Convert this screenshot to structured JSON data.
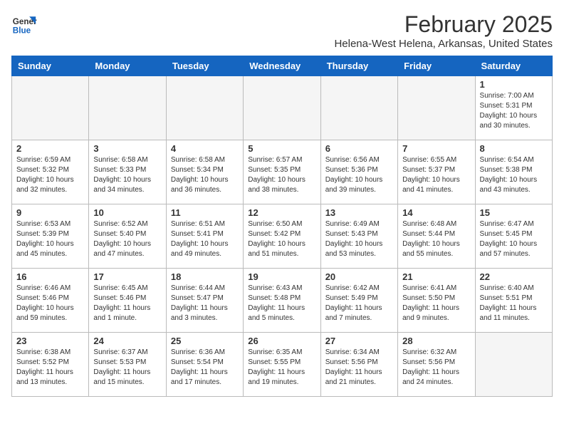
{
  "header": {
    "logo_line1": "General",
    "logo_line2": "Blue",
    "title": "February 2025",
    "subtitle": "Helena-West Helena, Arkansas, United States"
  },
  "weekdays": [
    "Sunday",
    "Monday",
    "Tuesday",
    "Wednesday",
    "Thursday",
    "Friday",
    "Saturday"
  ],
  "weeks": [
    [
      {
        "day": "",
        "info": ""
      },
      {
        "day": "",
        "info": ""
      },
      {
        "day": "",
        "info": ""
      },
      {
        "day": "",
        "info": ""
      },
      {
        "day": "",
        "info": ""
      },
      {
        "day": "",
        "info": ""
      },
      {
        "day": "1",
        "info": "Sunrise: 7:00 AM\nSunset: 5:31 PM\nDaylight: 10 hours\nand 30 minutes."
      }
    ],
    [
      {
        "day": "2",
        "info": "Sunrise: 6:59 AM\nSunset: 5:32 PM\nDaylight: 10 hours\nand 32 minutes."
      },
      {
        "day": "3",
        "info": "Sunrise: 6:58 AM\nSunset: 5:33 PM\nDaylight: 10 hours\nand 34 minutes."
      },
      {
        "day": "4",
        "info": "Sunrise: 6:58 AM\nSunset: 5:34 PM\nDaylight: 10 hours\nand 36 minutes."
      },
      {
        "day": "5",
        "info": "Sunrise: 6:57 AM\nSunset: 5:35 PM\nDaylight: 10 hours\nand 38 minutes."
      },
      {
        "day": "6",
        "info": "Sunrise: 6:56 AM\nSunset: 5:36 PM\nDaylight: 10 hours\nand 39 minutes."
      },
      {
        "day": "7",
        "info": "Sunrise: 6:55 AM\nSunset: 5:37 PM\nDaylight: 10 hours\nand 41 minutes."
      },
      {
        "day": "8",
        "info": "Sunrise: 6:54 AM\nSunset: 5:38 PM\nDaylight: 10 hours\nand 43 minutes."
      }
    ],
    [
      {
        "day": "9",
        "info": "Sunrise: 6:53 AM\nSunset: 5:39 PM\nDaylight: 10 hours\nand 45 minutes."
      },
      {
        "day": "10",
        "info": "Sunrise: 6:52 AM\nSunset: 5:40 PM\nDaylight: 10 hours\nand 47 minutes."
      },
      {
        "day": "11",
        "info": "Sunrise: 6:51 AM\nSunset: 5:41 PM\nDaylight: 10 hours\nand 49 minutes."
      },
      {
        "day": "12",
        "info": "Sunrise: 6:50 AM\nSunset: 5:42 PM\nDaylight: 10 hours\nand 51 minutes."
      },
      {
        "day": "13",
        "info": "Sunrise: 6:49 AM\nSunset: 5:43 PM\nDaylight: 10 hours\nand 53 minutes."
      },
      {
        "day": "14",
        "info": "Sunrise: 6:48 AM\nSunset: 5:44 PM\nDaylight: 10 hours\nand 55 minutes."
      },
      {
        "day": "15",
        "info": "Sunrise: 6:47 AM\nSunset: 5:45 PM\nDaylight: 10 hours\nand 57 minutes."
      }
    ],
    [
      {
        "day": "16",
        "info": "Sunrise: 6:46 AM\nSunset: 5:46 PM\nDaylight: 10 hours\nand 59 minutes."
      },
      {
        "day": "17",
        "info": "Sunrise: 6:45 AM\nSunset: 5:46 PM\nDaylight: 11 hours\nand 1 minute."
      },
      {
        "day": "18",
        "info": "Sunrise: 6:44 AM\nSunset: 5:47 PM\nDaylight: 11 hours\nand 3 minutes."
      },
      {
        "day": "19",
        "info": "Sunrise: 6:43 AM\nSunset: 5:48 PM\nDaylight: 11 hours\nand 5 minutes."
      },
      {
        "day": "20",
        "info": "Sunrise: 6:42 AM\nSunset: 5:49 PM\nDaylight: 11 hours\nand 7 minutes."
      },
      {
        "day": "21",
        "info": "Sunrise: 6:41 AM\nSunset: 5:50 PM\nDaylight: 11 hours\nand 9 minutes."
      },
      {
        "day": "22",
        "info": "Sunrise: 6:40 AM\nSunset: 5:51 PM\nDaylight: 11 hours\nand 11 minutes."
      }
    ],
    [
      {
        "day": "23",
        "info": "Sunrise: 6:38 AM\nSunset: 5:52 PM\nDaylight: 11 hours\nand 13 minutes."
      },
      {
        "day": "24",
        "info": "Sunrise: 6:37 AM\nSunset: 5:53 PM\nDaylight: 11 hours\nand 15 minutes."
      },
      {
        "day": "25",
        "info": "Sunrise: 6:36 AM\nSunset: 5:54 PM\nDaylight: 11 hours\nand 17 minutes."
      },
      {
        "day": "26",
        "info": "Sunrise: 6:35 AM\nSunset: 5:55 PM\nDaylight: 11 hours\nand 19 minutes."
      },
      {
        "day": "27",
        "info": "Sunrise: 6:34 AM\nSunset: 5:56 PM\nDaylight: 11 hours\nand 21 minutes."
      },
      {
        "day": "28",
        "info": "Sunrise: 6:32 AM\nSunset: 5:56 PM\nDaylight: 11 hours\nand 24 minutes."
      },
      {
        "day": "",
        "info": ""
      }
    ]
  ]
}
